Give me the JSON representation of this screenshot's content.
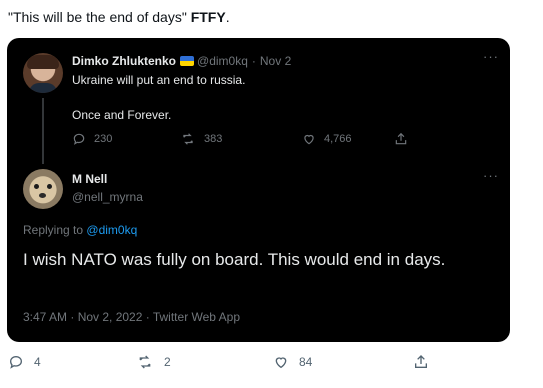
{
  "caption": {
    "quote": "\"This will be the end of days\"",
    "tag": "FTFY",
    "period": "."
  },
  "quoted_tweet": {
    "author_name": "Dimko Zhluktenko",
    "handle": "@dim0kq",
    "separator": "·",
    "date": "Nov 2",
    "line1": "Ukraine will put an end to russia.",
    "line2": "Once and Forever.",
    "replies": "230",
    "retweets": "383",
    "likes": "4,766",
    "more_icon": "more-horizontal-icon"
  },
  "reply_tweet": {
    "author_name": "M Nell",
    "handle": "@nell_myrna",
    "replying_prefix": "Replying to",
    "replying_to": "@dim0kq",
    "text": "I wish NATO was fully on board. This would end in days.",
    "meta": "3:47 AM · Nov 2, 2022 · Twitter Web App",
    "more_icon": "more-horizontal-icon"
  },
  "outer_actions": {
    "replies": "4",
    "retweets": "2",
    "likes": "84"
  },
  "colors": {
    "background": "#000000",
    "text": "#e7e9ea",
    "muted": "#71767b",
    "link": "#1d9bf0"
  }
}
